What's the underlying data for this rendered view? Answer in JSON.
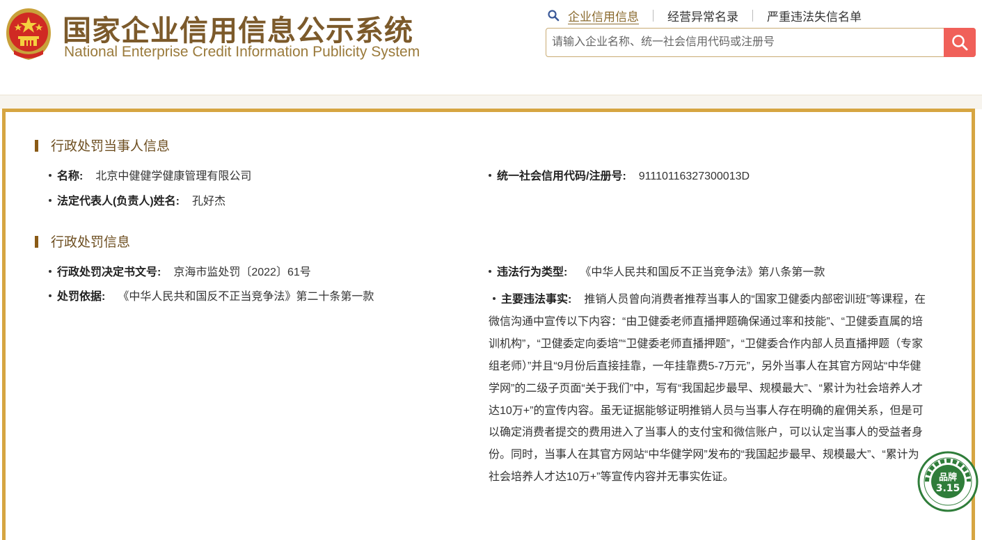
{
  "header": {
    "title_cn": "国家企业信用信息公示系统",
    "title_en": "National Enterprise Credit Information Publicity System",
    "logo_icon": "national-emblem-icon",
    "nav": [
      {
        "label": "企业信用信息",
        "active": true
      },
      {
        "label": "经营异常名录",
        "active": false
      },
      {
        "label": "严重违法失信名单",
        "active": false
      }
    ],
    "search": {
      "placeholder": "请输入企业名称、统一社会信用代码或注册号",
      "value": "",
      "button_icon": "search-icon"
    }
  },
  "sections": {
    "party": {
      "title": "行政处罚当事人信息",
      "name_label": "名称:",
      "name_value": "北京中健健学健康管理有限公司",
      "code_label": "统一社会信用代码/注册号:",
      "code_value": "91110116327300013D",
      "rep_label": "法定代表人(负责人)姓名:",
      "rep_value": "孔好杰"
    },
    "penalty": {
      "title": "行政处罚信息",
      "decision_label": "行政处罚决定书文号:",
      "decision_value": "京海市监处罚〔2022〕61号",
      "type_label": "违法行为类型:",
      "type_value": "《中华人民共和国反不正当竞争法》第八条第一款",
      "basis_label": "处罚依据:",
      "basis_value": "《中华人民共和国反不正当竞争法》第二十条第一款",
      "fact_label": "主要违法事实:",
      "fact_value": "推销人员曾向消费者推荐当事人的“国家卫健委内部密训班”等课程，在微信沟通中宣传以下内容：“由卫健委老师直播押题确保通过率和技能”、“卫健委直属的培训机构”，“卫健委定向委培”“卫健委老师直播押题”，“卫健委合作内部人员直播押题（专家组老师）”并且“9月份后直接挂靠，一年挂靠费5-7万元”，另外当事人在其官方网站“中华健学网”的二级子页面“关于我们”中，写有“我国起步最早、规模最大”、“累计为社会培养人才达10万+”的宣传内容。虽无证据能够证明推销人员与当事人存在明确的雇佣关系，但是可以确定消费者提交的费用进入了当事人的支付宝和微信账户，可以认定当事人的受益者身份。同时，当事人在其官方网站“中华健学网”发布的“我国起步最早、规模最大”、“累计为社会培养人才达10万+”等宣传内容并无事实佐证。"
    }
  },
  "badge": {
    "icon": "brand-315-badge-icon",
    "main_text": "品牌",
    "sub_text": "3.15",
    "ring_text": "打假维权 净化市场 引导消费 服务企业"
  },
  "colors": {
    "brand_brown": "#7c5a2b",
    "border_gold": "#d6a542",
    "search_red": "#f06059",
    "badge_green": "#2f7d3a"
  }
}
